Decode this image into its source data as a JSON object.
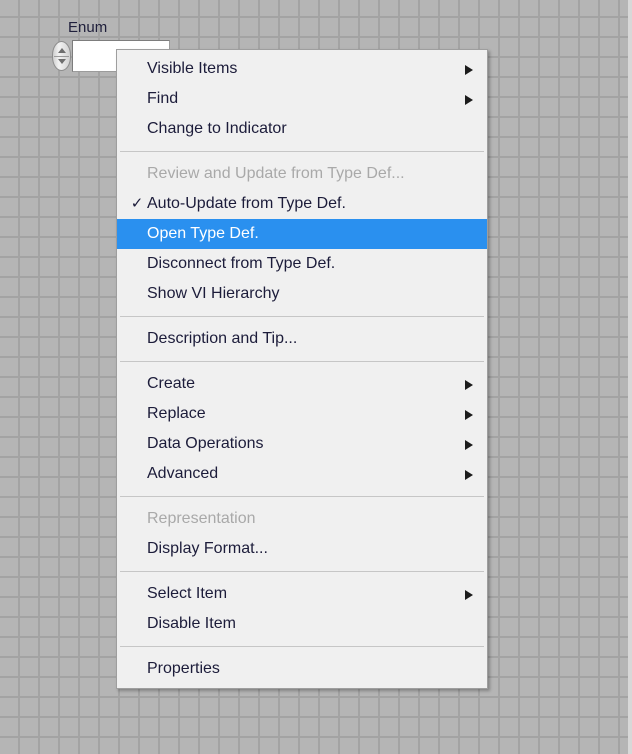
{
  "canvas": {
    "background_color": "#b5b5b5",
    "grid_line_color": "#a3a3a3"
  },
  "enum_control": {
    "label": "Enum",
    "value": "",
    "increment_icon": "increment-arrow-icon",
    "decrement_icon": "decrement-arrow-icon"
  },
  "context_menu": {
    "highlight_color": "#2a90ef",
    "background_color": "#f0f0f0",
    "disabled_color": "#a9a9a9",
    "groups": [
      {
        "items": [
          {
            "label": "Visible Items",
            "submenu": true,
            "checked": false,
            "disabled": false,
            "selected": false
          },
          {
            "label": "Find",
            "submenu": true,
            "checked": false,
            "disabled": false,
            "selected": false
          },
          {
            "label": "Change to Indicator",
            "submenu": false,
            "checked": false,
            "disabled": false,
            "selected": false
          }
        ]
      },
      {
        "items": [
          {
            "label": "Review and Update from Type Def...",
            "submenu": false,
            "checked": false,
            "disabled": true,
            "selected": false
          },
          {
            "label": "Auto-Update from Type Def.",
            "submenu": false,
            "checked": true,
            "disabled": false,
            "selected": false
          },
          {
            "label": "Open Type Def.",
            "submenu": false,
            "checked": false,
            "disabled": false,
            "selected": true
          },
          {
            "label": "Disconnect from Type Def.",
            "submenu": false,
            "checked": false,
            "disabled": false,
            "selected": false
          },
          {
            "label": "Show VI Hierarchy",
            "submenu": false,
            "checked": false,
            "disabled": false,
            "selected": false
          }
        ]
      },
      {
        "items": [
          {
            "label": "Description and Tip...",
            "submenu": false,
            "checked": false,
            "disabled": false,
            "selected": false
          }
        ]
      },
      {
        "items": [
          {
            "label": "Create",
            "submenu": true,
            "checked": false,
            "disabled": false,
            "selected": false
          },
          {
            "label": "Replace",
            "submenu": true,
            "checked": false,
            "disabled": false,
            "selected": false
          },
          {
            "label": "Data Operations",
            "submenu": true,
            "checked": false,
            "disabled": false,
            "selected": false
          },
          {
            "label": "Advanced",
            "submenu": true,
            "checked": false,
            "disabled": false,
            "selected": false
          }
        ]
      },
      {
        "items": [
          {
            "label": "Representation",
            "submenu": false,
            "checked": false,
            "disabled": true,
            "selected": false
          },
          {
            "label": "Display Format...",
            "submenu": false,
            "checked": false,
            "disabled": false,
            "selected": false
          }
        ]
      },
      {
        "items": [
          {
            "label": "Select Item",
            "submenu": true,
            "checked": false,
            "disabled": false,
            "selected": false
          },
          {
            "label": "Disable Item",
            "submenu": false,
            "checked": false,
            "disabled": false,
            "selected": false
          }
        ]
      },
      {
        "items": [
          {
            "label": "Properties",
            "submenu": false,
            "checked": false,
            "disabled": false,
            "selected": false
          }
        ]
      }
    ],
    "checkmark_glyph": "✓"
  }
}
